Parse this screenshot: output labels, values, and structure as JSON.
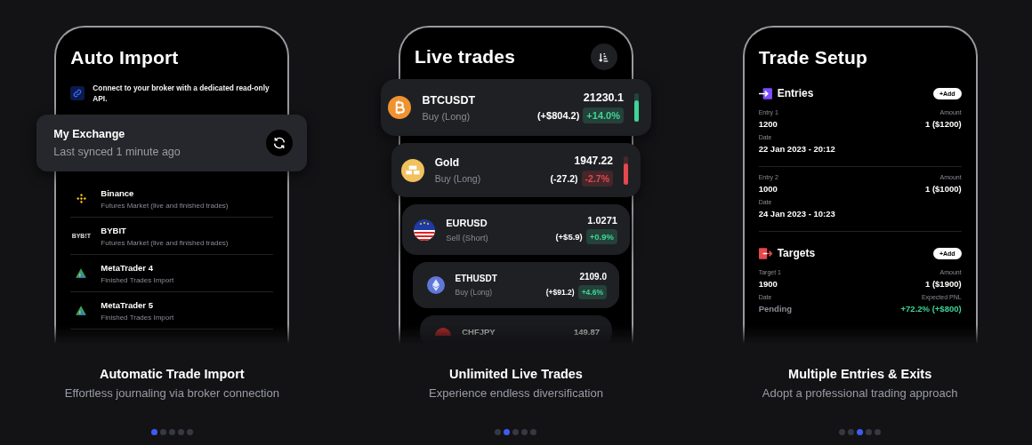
{
  "slides": [
    {
      "kind": "import",
      "phone": {
        "title": "Auto Import",
        "info": "Connect to your broker with a dedicated read-only API.",
        "exchange": {
          "name": "My Exchange",
          "status": "Last synced 1 minute ago"
        },
        "brokers": [
          {
            "name": "Binance",
            "description": "Futures Market (live and finished trades)"
          },
          {
            "name": "BYBIT",
            "description": "Futures Market (live and finished trades)",
            "logo_text": "BYB!T"
          },
          {
            "name": "MetaTrader 4",
            "description": "Finished Trades Import"
          },
          {
            "name": "MetaTrader 5",
            "description": "Finished Trades Import"
          }
        ]
      },
      "caption": {
        "title": "Automatic Trade Import",
        "subtitle": "Effortless journaling via broker connection"
      },
      "dots": [
        {
          "selected": true
        },
        {
          "selected": false
        },
        {
          "selected": false
        },
        {
          "selected": false
        },
        {
          "selected": false
        }
      ]
    },
    {
      "kind": "trades",
      "phone": {
        "title": "Live trades",
        "trades": [
          {
            "symbol": "BTCUSDT",
            "side": "Buy (Long)",
            "price": "21230.1",
            "pnl": "(+$804.2)",
            "percent": "+14.0%",
            "positive": true,
            "indicator": true
          },
          {
            "symbol": "Gold",
            "side": "Buy (Long)",
            "price": "1947.22",
            "pnl": "(-27.2)",
            "percent": "-2.7%",
            "positive": false,
            "indicator": true
          },
          {
            "symbol": "EURUSD",
            "side": "Sell (Short)",
            "price": "1.0271",
            "pnl": "(+$5.9)",
            "percent": "+0.9%",
            "positive": true,
            "indicator": false
          },
          {
            "symbol": "ETHUSDT",
            "side": "Buy (Long)",
            "price": "2109.0",
            "pnl": "(+$91.2)",
            "percent": "+4.6%",
            "positive": true,
            "indicator": false
          },
          {
            "symbol": "CHFJPY",
            "price": "149.87",
            "indicator": false
          }
        ]
      },
      "caption": {
        "title": "Unlimited Live Trades",
        "subtitle": "Experience endless diversification"
      },
      "dots": [
        {
          "selected": false
        },
        {
          "selected": true
        },
        {
          "selected": false
        },
        {
          "selected": false
        },
        {
          "selected": false
        }
      ]
    },
    {
      "kind": "setup",
      "phone": {
        "title": "Trade Setup",
        "sections": [
          {
            "kind": "entries",
            "title": "Entries",
            "button": "+Add",
            "items": [
              {
                "kind": "entry",
                "label": "Entry 1",
                "amount_label": "Amount",
                "value": "1200",
                "amount": "1 ($1200)",
                "date_label": "Date",
                "date": "22 Jan 2023 - 20:12"
              },
              {
                "kind": "entry",
                "label": "Entry 2",
                "amount_label": "Amount",
                "value": "1000",
                "amount": "1 ($1000)",
                "date_label": "Date",
                "date": "24 Jan 2023 - 10:23"
              }
            ]
          },
          {
            "kind": "targets",
            "title": "Targets",
            "button": "+Add",
            "items": [
              {
                "kind": "target",
                "label": "Target 1",
                "amount_label": "Amount",
                "value": "1900",
                "amount": "1 ($1900)",
                "date_label": "Date",
                "date": "Pending",
                "pnl_label": "Expected PNL",
                "pnl": "+72.2% (+$800)"
              }
            ]
          }
        ]
      },
      "caption": {
        "title": "Multiple Entries & Exits",
        "subtitle": "Adopt a professional trading approach"
      },
      "dots": [
        {
          "selected": false
        },
        {
          "selected": false
        },
        {
          "selected": true
        },
        {
          "selected": false
        },
        {
          "selected": false
        }
      ]
    }
  ]
}
